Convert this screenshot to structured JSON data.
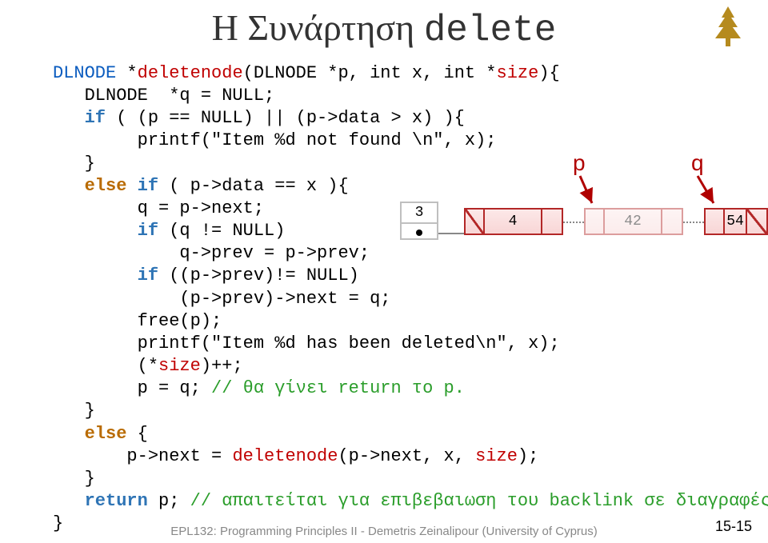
{
  "title": {
    "greek": "Η Συνάρτηση ",
    "func": "delete"
  },
  "code": {
    "l1a": "DLNODE",
    "l1b": " *",
    "l1c": "deletenode",
    "l1d": "(DLNODE *p, int x, int *",
    "l1e": "size",
    "l1f": "){",
    "l2": "   DLNODE  *q = NULL;",
    "l3a": "   ",
    "l3if": "if",
    "l3b": " ( (p == NULL) || (p->data > x) ){",
    "l4": "        printf(\"Item %d not found \\n\", x);",
    "l5": "   }",
    "l6a": "   ",
    "l6else": "else",
    "l6b": " ",
    "l6if": "if",
    "l6c": " ( p->data == x ){",
    "l7": "        q = p->next;",
    "l8a": "        ",
    "l8if": "if",
    "l8b": " (q != NULL)",
    "l9": "            q->prev = p->prev;",
    "l10a": "        ",
    "l10if": "if",
    "l10b": " ((p->prev)!= NULL)",
    "l11": "            (p->prev)->next = q;",
    "l12": "        free(p);",
    "l13": "        printf(\"Item %d has been deleted\\n\", x);",
    "l14a": "        (*",
    "l14b": "size",
    "l14c": ")++;",
    "l15a": "        p = q; ",
    "l15c": "// θα γίνει return το p.",
    "l16": "   }",
    "l17a": "   ",
    "l17else": "else",
    "l17b": " {",
    "l18a": "       p->next = ",
    "l18b": "deletenode",
    "l18c": "(p->next, x, ",
    "l18d": "size",
    "l18e": ");",
    "l19": "   }",
    "l20a": "   ",
    "l20ret": "return",
    "l20b": " p; ",
    "l20c": "// απαιτείται για επιβεβαιωση του backlink σε διαγραφές",
    "l21": "}"
  },
  "diagram": {
    "p": "p",
    "q": "q",
    "sizecount": "3",
    "v1": "4",
    "v2": "42",
    "v3": "54"
  },
  "footer": "EPL132: Programming Principles II - Demetris Zeinalipour (University of Cyprus)",
  "pagenum": "15-15"
}
